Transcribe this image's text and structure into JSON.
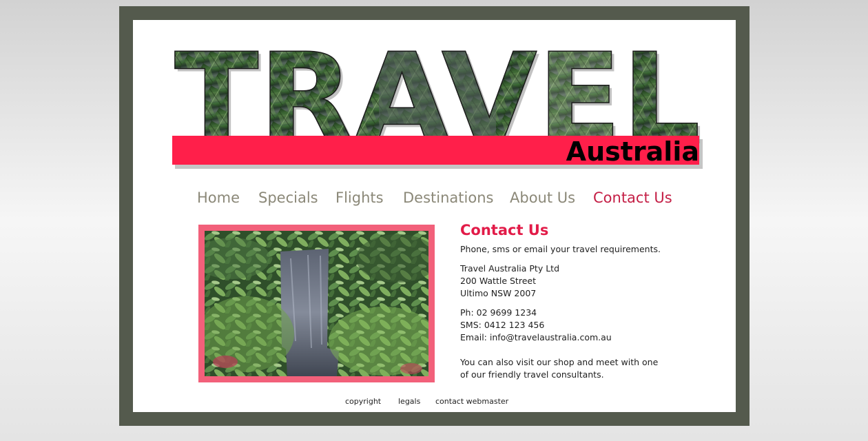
{
  "banner": {
    "title": "TRAVEL",
    "subtitle": "Australia",
    "stripe_color": "#ff1f4a"
  },
  "nav": {
    "items": [
      {
        "label": "Home",
        "active": false
      },
      {
        "label": "Specials",
        "active": false
      },
      {
        "label": "Flights",
        "active": false
      },
      {
        "label": "Destinations",
        "active": false
      },
      {
        "label": "About Us",
        "active": false
      },
      {
        "label": "Contact Us",
        "active": true
      }
    ],
    "color": "#8b8878",
    "active_color": "#c41e45"
  },
  "contact": {
    "heading": "Contact Us",
    "intro": "Phone, sms or email your travel requirements.",
    "address": [
      "Travel Australia Pty Ltd",
      "200 Wattle Street",
      "Ultimo NSW 2007"
    ],
    "phone": "Ph: 02 9699 1234",
    "sms": "SMS: 0412 123 456",
    "email": "Email: info@travelaustralia.com.au",
    "visit_lines": [
      "You can also visit our shop and meet with one",
      "of our friendly travel consultants."
    ]
  },
  "footer": {
    "links": [
      "copyright",
      "legals",
      "contact webmaster"
    ]
  },
  "colors": {
    "frame": "#545a4d",
    "heading": "#e21b48",
    "photo_border": "#f2607a"
  }
}
